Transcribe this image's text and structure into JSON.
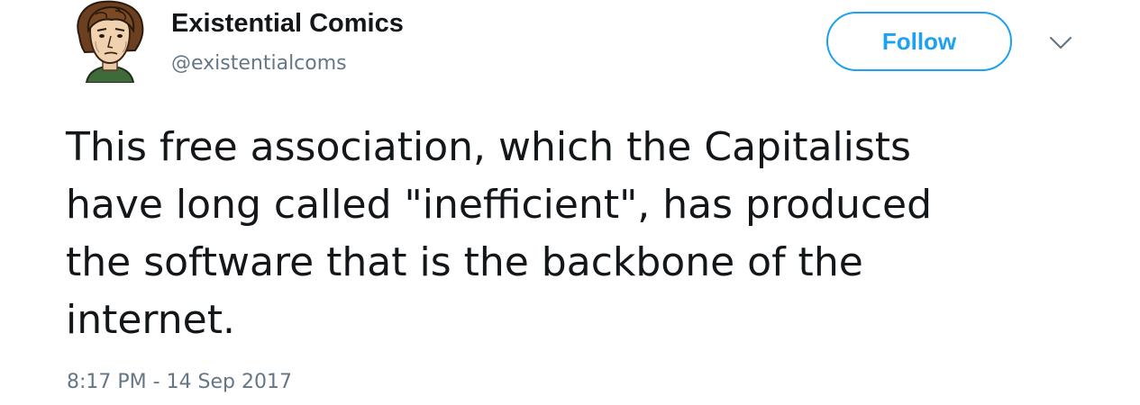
{
  "author": {
    "display_name": "Existential Comics",
    "handle": "@existentialcoms"
  },
  "follow_button": {
    "label": "Follow"
  },
  "tweet": {
    "lines": [
      "This free association, which the Capitalists",
      "have long called \"inefficient\", has produced",
      "the software that is the backbone of the",
      "internet."
    ],
    "timestamp": "8:17 PM - 14 Sep 2017"
  },
  "icons": {
    "avatar": "cartoon-avatar-icon",
    "more": "chevron-down-icon"
  },
  "colors": {
    "accent": "#1da1f2",
    "text": "#14171a",
    "secondary": "#657786"
  }
}
